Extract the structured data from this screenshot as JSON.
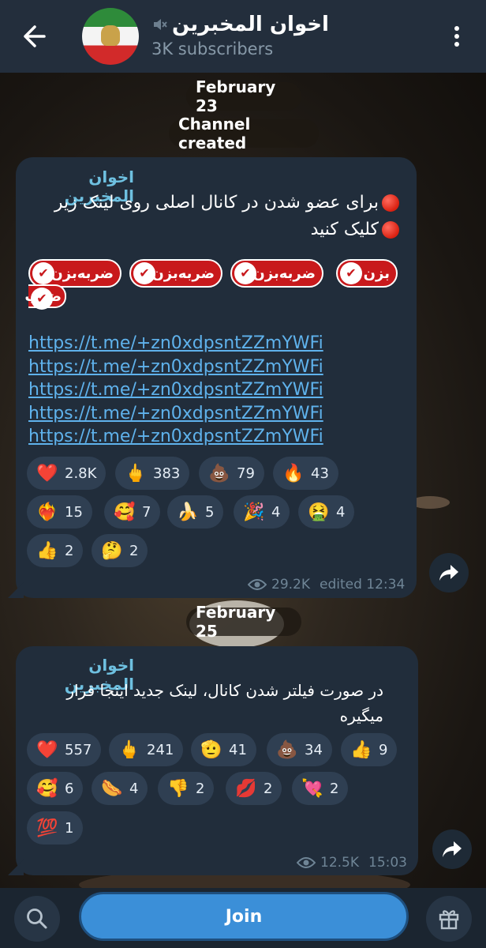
{
  "header": {
    "title": "اخوان المخبرین",
    "subscribers": "3K subscribers"
  },
  "service": {
    "date1": "February 23",
    "created": "Channel created",
    "date2": "February 25"
  },
  "message1": {
    "sender": "اخوان المخبرین",
    "text_line1": "برای عضو شدن در کانال اصلی روی لینک زیر",
    "text_line2": "کلیک کنید",
    "badge_text": "ضربه‌بزن",
    "badge_cut_left": "بزن",
    "badge_cut_row2": "ضرب",
    "links": [
      "https://t.me/+zn0xdpsntZZmYWFi",
      "https://t.me/+zn0xdpsntZZmYWFi",
      "https://t.me/+zn0xdpsntZZmYWFi",
      "https://t.me/+zn0xdpsntZZmYWFi",
      "https://t.me/+zn0xdpsntZZmYWFi"
    ],
    "reactions": [
      {
        "emoji": "❤️",
        "count": "2.8K"
      },
      {
        "emoji": "🖕",
        "count": "383"
      },
      {
        "emoji": "💩",
        "count": "79"
      },
      {
        "emoji": "🔥",
        "count": "43"
      },
      {
        "emoji": "❤️‍🔥",
        "count": "15"
      },
      {
        "emoji": "🥰",
        "count": "7"
      },
      {
        "emoji": "🍌",
        "count": "5"
      },
      {
        "emoji": "🎉",
        "count": "4"
      },
      {
        "emoji": "🤮",
        "count": "4"
      },
      {
        "emoji": "👍",
        "count": "2"
      },
      {
        "emoji": "🤔",
        "count": "2"
      }
    ],
    "views": "29.2K",
    "time": "edited 12:34"
  },
  "message2": {
    "sender": "اخوان المخبرین",
    "text_line1": "در صورت فیلتر شدن کانال، لینک جدید اینجا قرار",
    "text_line2": "میگیره",
    "reactions": [
      {
        "emoji": "❤️",
        "count": "557"
      },
      {
        "emoji": "🖕",
        "count": "241"
      },
      {
        "emoji": "🫡",
        "count": "41"
      },
      {
        "emoji": "💩",
        "count": "34"
      },
      {
        "emoji": "👍",
        "count": "9"
      },
      {
        "emoji": "🥰",
        "count": "6"
      },
      {
        "emoji": "🌭",
        "count": "4"
      },
      {
        "emoji": "👎",
        "count": "2"
      },
      {
        "emoji": "💋",
        "count": "2"
      },
      {
        "emoji": "💘",
        "count": "2"
      },
      {
        "emoji": "💯",
        "count": "1"
      }
    ],
    "views": "12.5K",
    "time": "15:03"
  },
  "bottom": {
    "join_label": "Join"
  },
  "colors": {
    "header_bg": "#232e3c",
    "bubble_bg": "#212d3b",
    "link": "#5fb2ec",
    "join_button": "#3b8fd8"
  }
}
